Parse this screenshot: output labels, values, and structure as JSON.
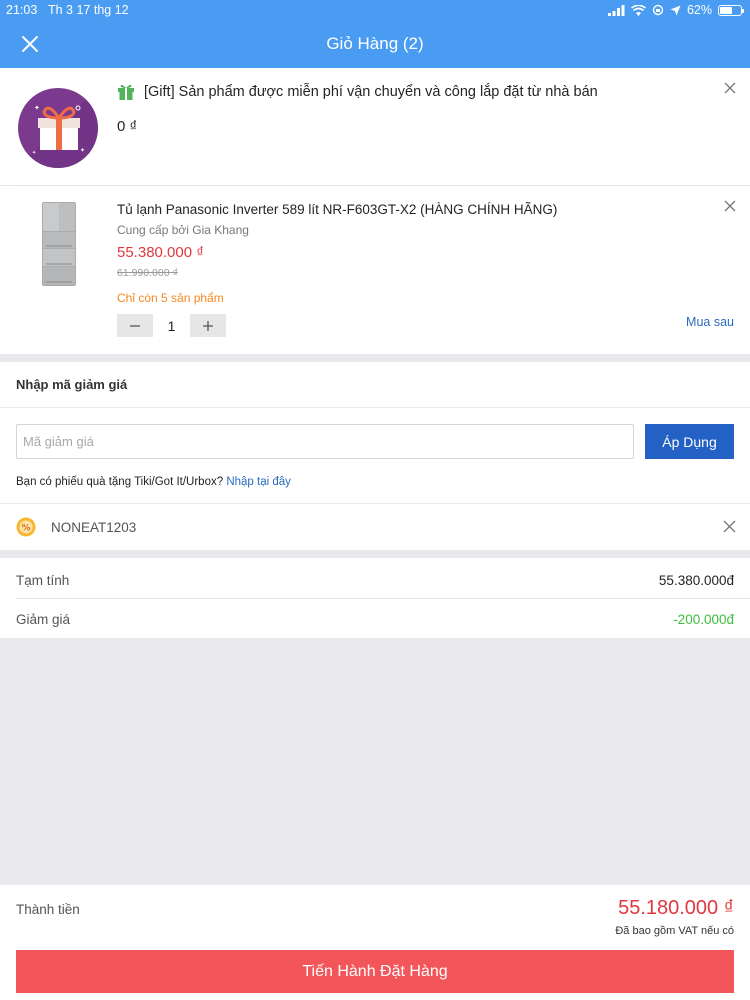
{
  "status_bar": {
    "time": "21:03",
    "date": "Th 3 17 thg 12",
    "battery": "62%"
  },
  "header": {
    "title": "Giỏ Hàng (2)",
    "close_icon": "close-icon",
    "color": "#4a9cf2"
  },
  "cart_items": [
    {
      "name": "[Gift] Sản phẩm được miễn phí vận chuyển và công lắp đặt từ nhà bán",
      "price": "0 ₫",
      "icon": "gift-icon"
    },
    {
      "name": "Tủ lạnh Panasonic Inverter 589 lít NR-F603GT-X2 (HÀNG CHÍNH HÃNG)",
      "seller": "Cung cấp bởi Gia Khang",
      "price": "55.380.000 ₫",
      "old_price": "61.990.000 ₫",
      "stock": "Chỉ còn 5 sản phẩm",
      "quantity": "1",
      "buy_later": "Mua sau"
    }
  ],
  "promo": {
    "heading": "Nhập mã giảm giá",
    "placeholder": "Mã giảm giá",
    "apply_label": "Áp Dụng",
    "voucher_question": "Bạn có phiếu quà tặng Tiki/Got It/Urbox?",
    "voucher_link": "Nhập tại đây",
    "applied_code": "NONEAT1203"
  },
  "summary": {
    "subtotal_label": "Tạm tính",
    "subtotal_value": "55.380.000đ",
    "discount_label": "Giảm giá",
    "discount_value": "-200.000đ"
  },
  "footer": {
    "total_label": "Thành tiền",
    "total_value": "55.180.000 ₫",
    "vat_note": "Đã bao gồm VAT nếu có",
    "checkout_label": "Tiến Hành Đặt Hàng"
  },
  "colors": {
    "accent": "#4a9cf2",
    "price_red": "#e0383e",
    "apply_blue": "#2361c4",
    "checkout_red": "#f2565a",
    "discount_green": "#3cbf3c",
    "stock_orange": "#f5871f"
  }
}
